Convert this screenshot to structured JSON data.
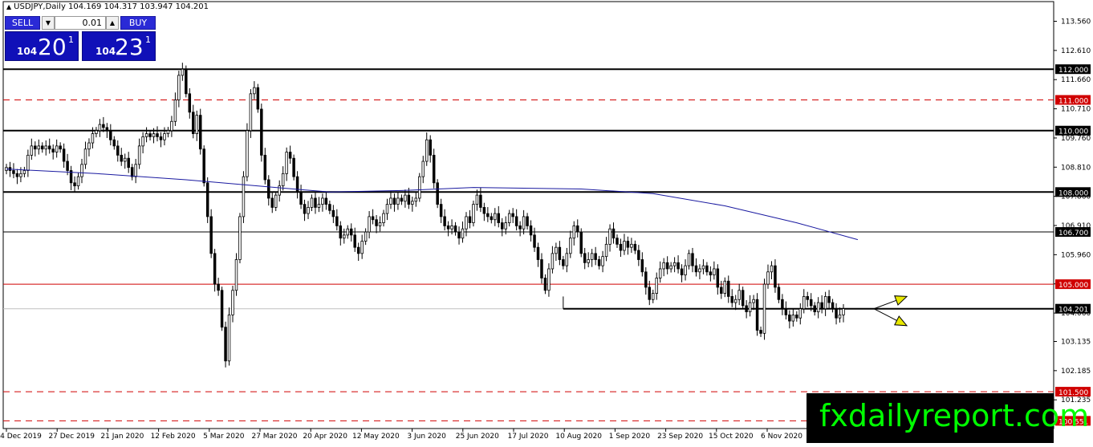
{
  "header": {
    "symbol_line": "USDJPY,Daily  104.169 104.317 103.947 104.201"
  },
  "trade_panel": {
    "sell_label": "SELL",
    "buy_label": "BUY",
    "lot": "0.01",
    "sell_small": "104",
    "sell_big": "20",
    "sell_sup": "1",
    "buy_small": "104",
    "buy_big": "23",
    "buy_sup": "1"
  },
  "watermark": "fxdailyreport.com",
  "colors": {
    "bull": "#000000",
    "bear": "#000000",
    "ma": "#1a1aa0",
    "support_red": "#d00000",
    "black_line": "#000000",
    "arrow_fill": "#e8e800"
  },
  "chart_data": {
    "type": "candlestick",
    "symbol": "USDJPY",
    "timeframe": "Daily",
    "ylim": [
      100.3,
      114.2
    ],
    "y_ticks": [
      "113.560",
      "112.610",
      "111.660",
      "110.710",
      "109.760",
      "108.810",
      "107.860",
      "106.910",
      "105.960",
      "105.010",
      "104.060",
      "103.135",
      "102.185",
      "101.235"
    ],
    "x_labels": [
      "4 Dec 2019",
      "27 Dec 2019",
      "21 Jan 2020",
      "12 Feb 2020",
      "5 Mar 2020",
      "27 Mar 2020",
      "20 Apr 2020",
      "12 May 2020",
      "3 Jun 2020",
      "25 Jun 2020",
      "17 Jul 2020",
      "10 Aug 2020",
      "1 Sep 2020",
      "23 Sep 2020",
      "15 Oct 2020",
      "6 Nov 2020"
    ],
    "levels": [
      {
        "price": 112.0,
        "label": "112.000",
        "style": "solid"
      },
      {
        "price": 111.0,
        "label": "111.000",
        "style": "dashed-red"
      },
      {
        "price": 110.0,
        "label": "110.000",
        "style": "solid"
      },
      {
        "price": 108.0,
        "label": "108.000",
        "style": "solid"
      },
      {
        "price": 106.7,
        "label": "106.700",
        "style": "solid-thin"
      },
      {
        "price": 105.0,
        "label": "105.000",
        "style": "red"
      },
      {
        "price": 104.201,
        "label": "104.201",
        "style": "current"
      },
      {
        "price": 101.5,
        "label": "101.500",
        "style": "dashed-red"
      },
      {
        "price": 100.551,
        "label": "100.551",
        "style": "dashed-red"
      }
    ],
    "closes": [
      108.8,
      108.7,
      108.6,
      108.5,
      108.6,
      108.7,
      109.2,
      109.5,
      109.4,
      109.5,
      109.4,
      109.5,
      109.4,
      109.3,
      109.5,
      109.4,
      109.0,
      108.7,
      108.3,
      108.2,
      108.5,
      108.9,
      109.4,
      109.6,
      109.9,
      110.0,
      110.2,
      110.1,
      110.0,
      109.7,
      109.5,
      109.2,
      109.0,
      109.1,
      108.8,
      108.5,
      108.9,
      109.5,
      109.8,
      109.9,
      109.8,
      109.9,
      109.8,
      109.7,
      109.9,
      110.0,
      110.3,
      111.0,
      111.8,
      112.0,
      111.2,
      110.6,
      109.9,
      110.5,
      109.4,
      108.3,
      107.2,
      106.0,
      105.0,
      104.8,
      103.6,
      102.5,
      104.0,
      104.8,
      105.8,
      107.2,
      108.5,
      110.0,
      111.2,
      111.4,
      110.7,
      109.2,
      108.4,
      107.8,
      107.5,
      107.9,
      108.2,
      108.6,
      109.3,
      109.1,
      108.5,
      108.0,
      107.6,
      107.3,
      107.5,
      107.8,
      107.5,
      107.6,
      107.8,
      107.6,
      107.4,
      107.2,
      106.9,
      106.5,
      106.6,
      106.8,
      106.6,
      106.2,
      106.0,
      106.4,
      106.7,
      107.2,
      107.1,
      106.9,
      107.0,
      107.3,
      107.6,
      107.8,
      107.6,
      107.8,
      107.7,
      107.9,
      107.6,
      107.7,
      107.8,
      108.5,
      109.0,
      109.7,
      109.2,
      108.3,
      107.6,
      107.2,
      106.9,
      106.8,
      106.9,
      106.7,
      106.5,
      106.8,
      107.2,
      107.0,
      107.6,
      107.9,
      107.5,
      107.3,
      107.2,
      107.1,
      107.3,
      107.0,
      106.8,
      107.0,
      107.3,
      107.2,
      106.9,
      106.8,
      107.2,
      106.9,
      106.6,
      106.2,
      105.8,
      105.2,
      104.8,
      105.5,
      106.0,
      106.2,
      105.8,
      105.6,
      106.0,
      106.5,
      106.9,
      106.7,
      106.0,
      105.7,
      105.8,
      106.0,
      105.8,
      105.6,
      105.9,
      106.3,
      106.8,
      106.5,
      106.3,
      106.1,
      106.4,
      106.2,
      106.3,
      106.1,
      105.8,
      105.4,
      104.9,
      104.5,
      104.7,
      105.2,
      105.5,
      105.7,
      105.5,
      105.6,
      105.7,
      105.5,
      105.3,
      105.6,
      106.0,
      105.6,
      105.4,
      105.5,
      105.6,
      105.4,
      105.3,
      105.5,
      104.9,
      104.7,
      105.1,
      104.6,
      104.4,
      104.5,
      104.8,
      104.3,
      104.1,
      104.4,
      104.5,
      103.5,
      103.4,
      105.0,
      105.4,
      105.6,
      104.9,
      104.5,
      104.2,
      104.0,
      103.8,
      104.0,
      103.9,
      104.2,
      104.6,
      104.5,
      104.3,
      104.1,
      104.4,
      104.2,
      104.6,
      104.4,
      104.2,
      103.9,
      104.0,
      104.201
    ],
    "ma_points": [
      [
        0,
        108.75
      ],
      [
        25,
        108.6
      ],
      [
        50,
        108.4
      ],
      [
        75,
        108.15
      ],
      [
        90,
        108.0
      ],
      [
        110,
        108.05
      ],
      [
        130,
        108.15
      ],
      [
        160,
        108.1
      ],
      [
        180,
        107.95
      ],
      [
        200,
        107.55
      ],
      [
        220,
        107.0
      ],
      [
        237,
        106.45
      ]
    ],
    "annotations": [
      {
        "type": "arrow",
        "from_bar": 237,
        "from_price": 104.2,
        "to_bar": 253,
        "to_price": 104.6,
        "direction": "up"
      },
      {
        "type": "arrow",
        "from_bar": 237,
        "from_price": 104.2,
        "to_bar": 251,
        "to_price": 103.65,
        "direction": "down"
      }
    ],
    "support_segment": {
      "from_bar": 155,
      "to_bar": 237,
      "price": 104.201
    }
  }
}
